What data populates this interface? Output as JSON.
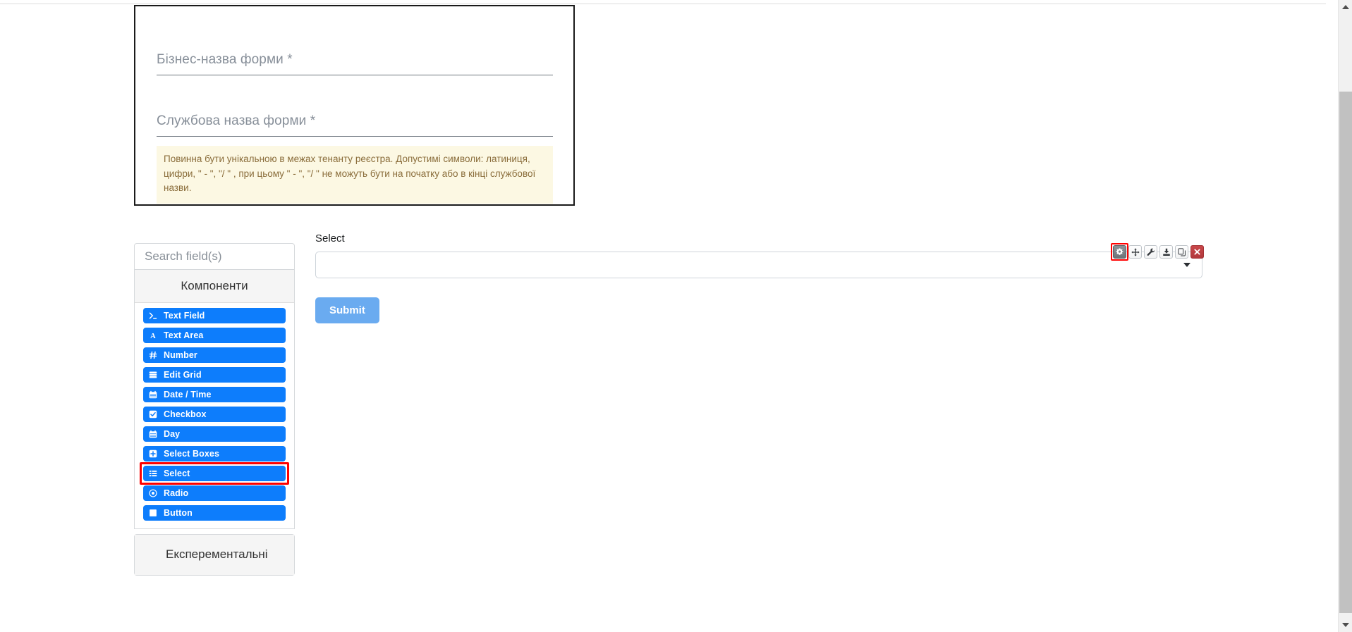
{
  "form_meta": {
    "business_name_label": "Бізнес-назва форми *",
    "business_name_value": "",
    "service_name_label": "Службова назва форми *",
    "service_name_value": "",
    "hint": "Повинна бути унікальною в межах тенанту реєстра. Допустимі символи: латиниця, цифри, \" - \", \"/ \" , при цьому  \" - \", \"/ \" не можуть бути на початку або в кінці службової назви."
  },
  "sidebar": {
    "search": {
      "placeholder": "Search field(s)",
      "value": ""
    },
    "groups": [
      {
        "title": "Компоненти",
        "items": [
          {
            "label": "Text Field",
            "icon": "terminal-icon",
            "highlighted": false
          },
          {
            "label": "Text Area",
            "icon": "font-a-icon",
            "highlighted": false
          },
          {
            "label": "Number",
            "icon": "hash-icon",
            "highlighted": false
          },
          {
            "label": "Edit Grid",
            "icon": "edit-grid-icon",
            "highlighted": false
          },
          {
            "label": "Date / Time",
            "icon": "calendar-icon",
            "highlighted": false
          },
          {
            "label": "Checkbox",
            "icon": "checkbox-icon",
            "highlighted": false
          },
          {
            "label": "Day",
            "icon": "calendar-icon",
            "highlighted": false
          },
          {
            "label": "Select Boxes",
            "icon": "plus-square-icon",
            "highlighted": false
          },
          {
            "label": "Select",
            "icon": "list-icon",
            "highlighted": true
          },
          {
            "label": "Radio",
            "icon": "radio-icon",
            "highlighted": false
          },
          {
            "label": "Button",
            "icon": "square-icon",
            "highlighted": false
          }
        ]
      },
      {
        "title": "Експерементальні",
        "items": []
      }
    ]
  },
  "preview": {
    "component_toolbar": [
      {
        "name": "settings-gear-icon",
        "style": "active",
        "ringed": true
      },
      {
        "name": "move-arrows-icon",
        "style": "light",
        "ringed": false
      },
      {
        "name": "wrench-icon",
        "style": "light",
        "ringed": false
      },
      {
        "name": "save-icon",
        "style": "light",
        "ringed": false
      },
      {
        "name": "copy-icon",
        "style": "light",
        "ringed": false
      },
      {
        "name": "remove-x-icon",
        "style": "danger",
        "ringed": false
      }
    ],
    "select_field": {
      "label": "Select",
      "value": ""
    },
    "submit_label": "Submit"
  },
  "colors": {
    "component_blue": "#0d7dfc",
    "highlight_red": "#ff0000",
    "submit_blue": "#6aabf0",
    "hint_bg": "#fcf8e3",
    "hint_text": "#8a6d3b",
    "danger_red": "#b2393c"
  }
}
